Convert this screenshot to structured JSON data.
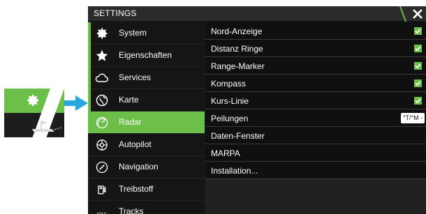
{
  "window": {
    "title": "SETTINGS",
    "accent_color": "#6cc04a"
  },
  "sidebar": {
    "items": [
      {
        "label": "System",
        "icon": "gear-icon"
      },
      {
        "label": "Eigenschaften",
        "icon": "star-icon"
      },
      {
        "label": "Services",
        "icon": "cloud-icon"
      },
      {
        "label": "Karte",
        "icon": "globe-icon"
      },
      {
        "label": "Radar",
        "icon": "radar-icon",
        "active": true
      },
      {
        "label": "Autopilot",
        "icon": "autopilot-icon"
      },
      {
        "label": "Navigation",
        "icon": "compass-icon"
      },
      {
        "label": "Treibstoff",
        "icon": "fuel-icon"
      },
      {
        "label": "Tracks",
        "icon": "tracks-icon"
      }
    ]
  },
  "radar_settings": {
    "rows": [
      {
        "label": "Nord-Anzeige",
        "checked": true
      },
      {
        "label": "Distanz Ringe",
        "checked": true
      },
      {
        "label": "Range-Marker",
        "checked": true
      },
      {
        "label": "Kompass",
        "checked": true
      },
      {
        "label": "Kurs-Linie",
        "checked": true
      },
      {
        "label": "Peilungen",
        "value": "°T/°M -"
      },
      {
        "label": "Daten-Fenster"
      },
      {
        "label": "MARPA"
      },
      {
        "label": "Installation..."
      }
    ]
  }
}
